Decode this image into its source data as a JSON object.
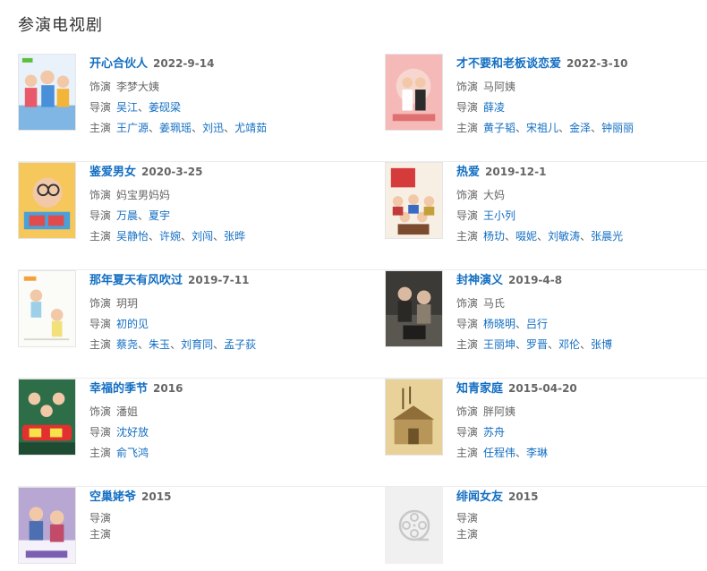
{
  "section": {
    "title": "参演电视剧"
  },
  "labels": {
    "role": "饰演",
    "director": "导演",
    "cast": "主演"
  },
  "colors": {
    "link": "#136ec2",
    "text": "#666666",
    "title": "#333333",
    "divider": "#ececec"
  },
  "dramas": [
    {
      "title": "开心合伙人",
      "year": "2022-9-14",
      "role": "李梦大姨",
      "directors": [
        "吴江",
        "姜砚梁"
      ],
      "cast": [
        "王广源",
        "姜珮瑶",
        "刘迅",
        "尤靖茹"
      ],
      "poster": "poster-kaixin"
    },
    {
      "title": "才不要和老板谈恋爱",
      "year": "2022-3-10",
      "role": "马阿姨",
      "directors": [
        "薛凌"
      ],
      "cast": [
        "黄子韬",
        "宋祖儿",
        "金泽",
        "钟丽丽"
      ],
      "poster": "poster-caibuyao"
    },
    {
      "title": "鉴爱男女",
      "year": "2020-3-25",
      "role": "妈宝男妈妈",
      "directors": [
        "万晨",
        "夏宇"
      ],
      "cast": [
        "吴静怡",
        "许婉",
        "刘闯",
        "张晔"
      ],
      "poster": "poster-jianai"
    },
    {
      "title": "热爱",
      "year": "2019-12-1",
      "role": "大妈",
      "directors": [
        "王小列"
      ],
      "cast": [
        "杨玏",
        "啜妮",
        "刘敏涛",
        "张晨光"
      ],
      "poster": "poster-reai"
    },
    {
      "title": "那年夏天有风吹过",
      "year": "2019-7-11",
      "role": "玥玥",
      "directors": [
        "初的见"
      ],
      "cast": [
        "蔡尧",
        "朱玉",
        "刘育同",
        "孟子荻"
      ],
      "poster": "poster-nanian"
    },
    {
      "title": "封神演义",
      "year": "2019-4-8",
      "role": "马氏",
      "directors": [
        "杨晓明",
        "吕行"
      ],
      "cast": [
        "王丽坤",
        "罗晋",
        "邓伦",
        "张博"
      ],
      "poster": "poster-fengshen"
    },
    {
      "title": "幸福的季节",
      "year": "2016",
      "role": "潘姐",
      "directors": [
        "沈好放"
      ],
      "cast": [
        "俞飞鸿"
      ],
      "poster": "poster-xingfu"
    },
    {
      "title": "知青家庭",
      "year": "2015-04-20",
      "role": "胖阿姨",
      "directors": [
        "苏舟"
      ],
      "cast": [
        "任程伟",
        "李琳"
      ],
      "poster": "poster-zhiqing"
    },
    {
      "title": "空巢姥爷",
      "year": "2015",
      "role": "",
      "directors": [],
      "cast": [],
      "poster": "poster-kongchao"
    },
    {
      "title": "绯闻女友",
      "year": "2015",
      "role": "",
      "directors": [],
      "cast": [],
      "poster": "film-reel-icon"
    }
  ]
}
